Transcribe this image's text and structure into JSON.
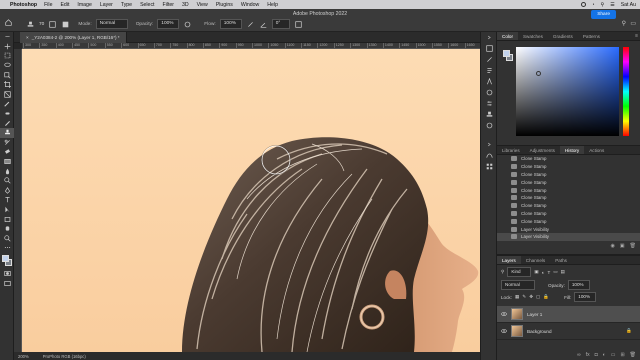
{
  "menubar": {
    "app": "Photoshop",
    "items": [
      "File",
      "Edit",
      "Image",
      "Layer",
      "Type",
      "Select",
      "Filter",
      "3D",
      "View",
      "Plugins",
      "Window",
      "Help"
    ],
    "clock": "Sat Au"
  },
  "options": {
    "window_title": "Adobe Photoshop 2022",
    "brush_size": "70",
    "mode_label": "Mode:",
    "mode_value": "Normal",
    "opacity_label": "Opacity:",
    "opacity_value": "100%",
    "flow_label": "Flow:",
    "flow_value": "100%",
    "angle_value": "0°",
    "share_label": "Share"
  },
  "document": {
    "tab_title": "_Y2A0384-2 @ 200% (Layer 1, RGB/16*) *",
    "zoom": "200%",
    "profile": "ProPhoto RGB (16bpc)"
  },
  "rulers": {
    "top_ticks": [
      "300",
      "350",
      "400",
      "450",
      "500",
      "550",
      "600",
      "650",
      "700",
      "750",
      "800",
      "850",
      "900",
      "950",
      "1000",
      "1050",
      "1100",
      "1150",
      "1200",
      "1250",
      "1300",
      "1350",
      "1400",
      "1450",
      "1500",
      "1550",
      "1600",
      "1650"
    ]
  },
  "color_panel": {
    "tabs": [
      "Color",
      "Swatches",
      "Gradients",
      "Patterns"
    ],
    "active_tab": "Color",
    "hue_color": "#2a6bff",
    "fg_color": "#c2d2ec",
    "bg_color": "#7a8088"
  },
  "history_panel": {
    "tabs": [
      "Libraries",
      "Adjustments",
      "History",
      "Actions"
    ],
    "active_tab": "History",
    "items": [
      "Clone Stamp",
      "Clone Stamp",
      "Clone Stamp",
      "Clone Stamp",
      "Clone Stamp",
      "Clone Stamp",
      "Clone Stamp",
      "Clone Stamp",
      "Clone Stamp",
      "Layer Visibility",
      "Layer Visibility"
    ]
  },
  "layers_panel": {
    "tabs": [
      "Layers",
      "Channels",
      "Paths"
    ],
    "active_tab": "Layers",
    "kind_label": "Kind",
    "blend_mode": "Normal",
    "opacity_label": "Opacity:",
    "opacity_value": "100%",
    "lock_label": "Lock:",
    "fill_label": "Fill:",
    "fill_value": "100%",
    "layers": [
      {
        "name": "Layer 1",
        "selected": true,
        "locked": false
      },
      {
        "name": "Background",
        "selected": false,
        "locked": true
      }
    ]
  },
  "colors": {
    "sky": "#fcd7ae",
    "accent": "#1473e6"
  }
}
